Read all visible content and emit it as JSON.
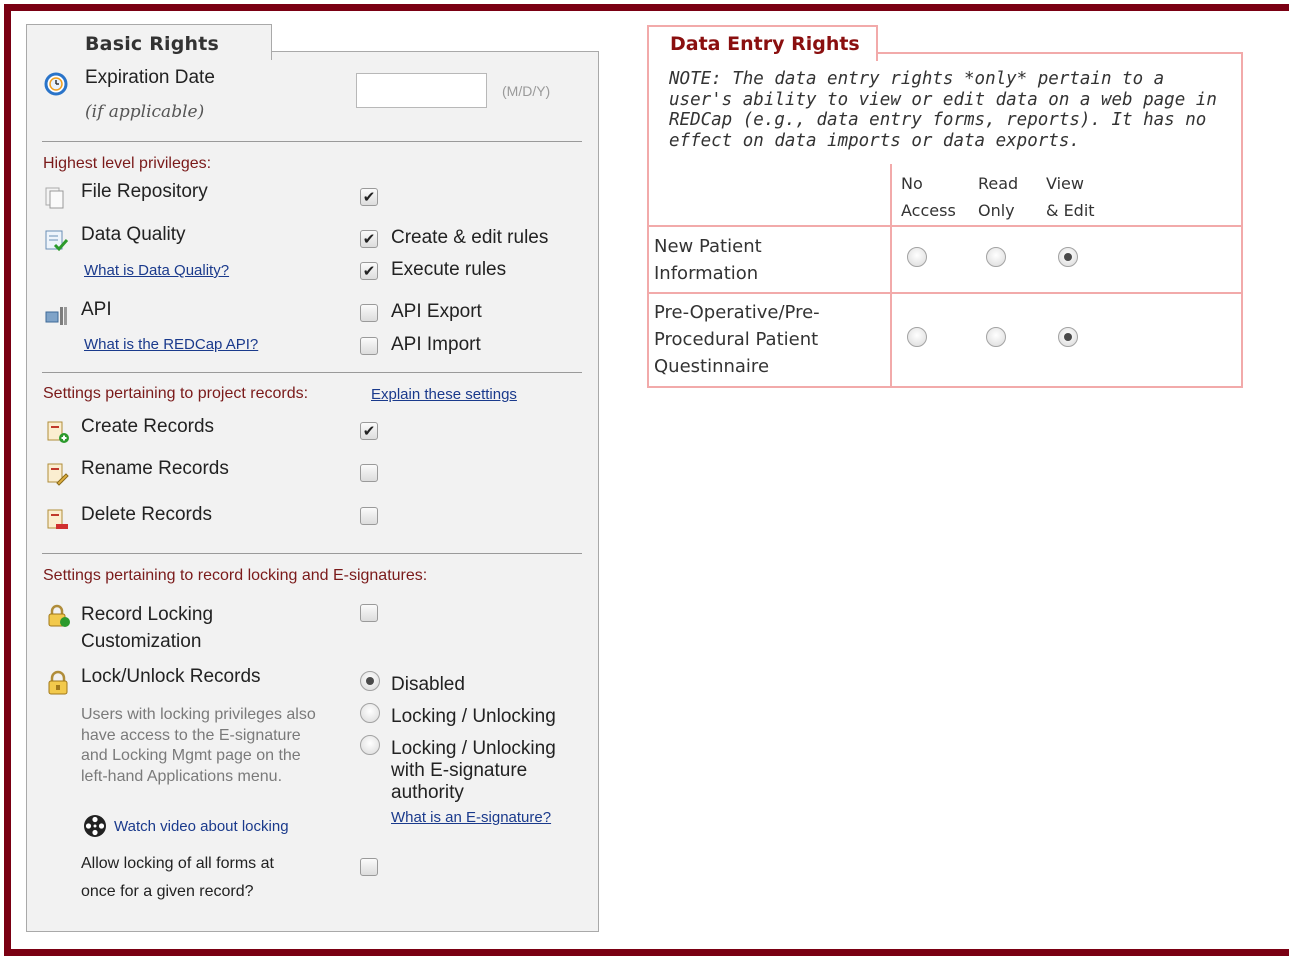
{
  "basic_rights": {
    "tab_label": "Basic Rights",
    "expiration": {
      "label": "Expiration Date",
      "sublabel": "(if applicable)",
      "value": "",
      "format_hint": "(M/D/Y)"
    },
    "highest_header": "Highest level privileges:",
    "file_repository": {
      "label": "File Repository",
      "checked": true
    },
    "data_quality": {
      "label": "Data Quality",
      "help_link": "What is Data Quality?",
      "options": [
        {
          "label": "Create & edit rules",
          "checked": true
        },
        {
          "label": "Execute rules",
          "checked": true
        }
      ]
    },
    "api": {
      "label": "API",
      "help_link": "What is the REDCap API?",
      "options": [
        {
          "label": "API Export",
          "checked": false
        },
        {
          "label": "API Import",
          "checked": false
        }
      ]
    },
    "records_header": "Settings pertaining to project records:",
    "records_help_link": "Explain these settings",
    "create_records": {
      "label": "Create Records",
      "checked": true
    },
    "rename_records": {
      "label": "Rename Records",
      "checked": false
    },
    "delete_records": {
      "label": "Delete Records",
      "checked": false
    },
    "locking_header": "Settings pertaining to record locking and E-signatures:",
    "record_locking_customization": {
      "label_line1": "Record Locking",
      "label_line2": "Customization",
      "checked": false
    },
    "lock_unlock": {
      "label": "Lock/Unlock Records",
      "help_text": "Users with locking privileges also have access to the E-signature and Locking Mgmt page on the left-hand Applications menu.",
      "video_link": "Watch video about locking",
      "options": [
        {
          "label": "Disabled",
          "selected": true
        },
        {
          "label": "Locking / Unlocking",
          "selected": false
        },
        {
          "label": "Locking / Unlocking with E-signature authority",
          "selected": false
        }
      ],
      "esig_link": "What is an E-signature?"
    },
    "lock_all_forms": {
      "label_line1": "Allow locking of all forms at",
      "label_line2": "once for a given record?",
      "checked": false
    }
  },
  "data_entry_rights": {
    "tab_label": "Data Entry Rights",
    "note": "NOTE: The data entry rights *only* pertain to a user's ability to view or edit data on a web page in REDCap (e.g., data entry forms, reports). It has no effect on data imports or data exports.",
    "columns": [
      {
        "line1": "No",
        "line2": "Access"
      },
      {
        "line1": "Read",
        "line2": "Only"
      },
      {
        "line1": "View",
        "line2": "& Edit"
      }
    ],
    "forms": [
      {
        "lines": [
          "New Patient",
          "Information"
        ],
        "selected": 2
      },
      {
        "lines": [
          "Pre-Operative/Pre-",
          "Procedural Patient",
          "Questinnaire"
        ],
        "selected": 2
      }
    ]
  },
  "colors": {
    "frame": "#7a0013",
    "panel_bg": "#f2f2f2",
    "section_text": "#7a1a1a",
    "link": "#1a3a8c",
    "der_border": "#f2aaaa",
    "der_title": "#8a0f0f"
  }
}
